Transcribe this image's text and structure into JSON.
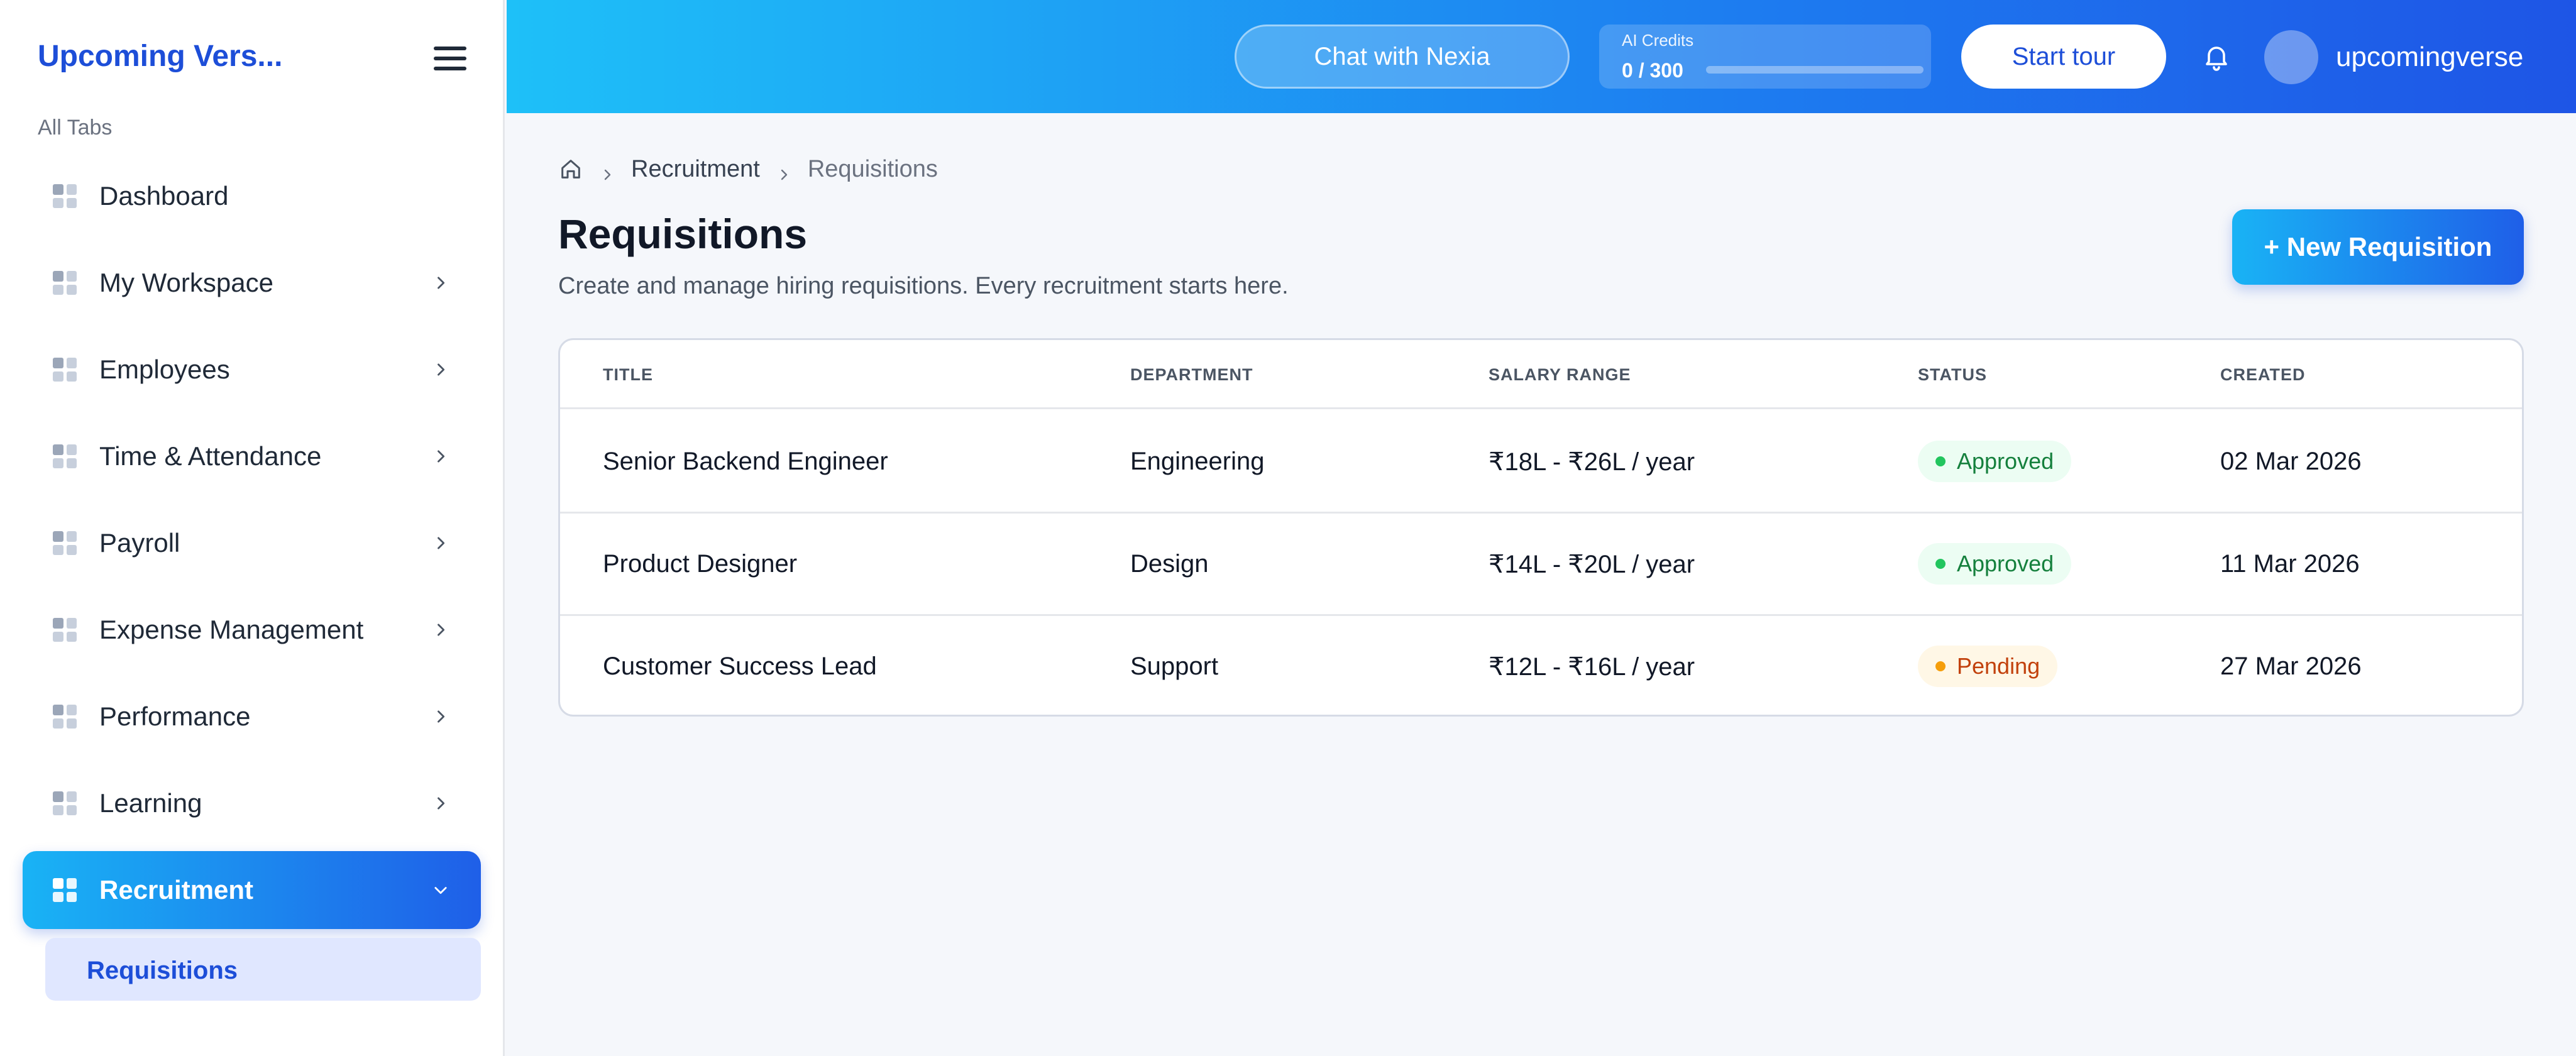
{
  "sidebar": {
    "brand": "Upcoming Vers...",
    "section_label": "All Tabs",
    "items": [
      {
        "label": "Dashboard",
        "has_chevron": false
      },
      {
        "label": "My Workspace",
        "has_chevron": true
      },
      {
        "label": "Employees",
        "has_chevron": true
      },
      {
        "label": "Time & Attendance",
        "has_chevron": true
      },
      {
        "label": "Payroll",
        "has_chevron": true
      },
      {
        "label": "Expense Management",
        "has_chevron": true
      },
      {
        "label": "Performance",
        "has_chevron": true
      },
      {
        "label": "Learning",
        "has_chevron": true
      },
      {
        "label": "Recruitment",
        "active": true,
        "expanded": true
      }
    ],
    "sub_item": "Requisitions"
  },
  "topbar": {
    "chat_label": "Chat with Nexia",
    "credits_label": "AI Credits",
    "credits_value": "0 / 300",
    "credits_used_fraction": 0.0,
    "tour_label": "Start tour",
    "username": "upcomingverse",
    "icons": [
      "bell-icon",
      "avatar"
    ]
  },
  "breadcrumb": {
    "home_icon": "home-icon",
    "items": [
      "Recruitment",
      "Requisitions"
    ]
  },
  "page": {
    "title": "Requisitions",
    "subtitle": "Create and manage hiring requisitions. Every recruitment starts here.",
    "new_button": "+ New Requisition"
  },
  "table": {
    "headers": [
      "TITLE",
      "DEPARTMENT",
      "SALARY RANGE",
      "STATUS",
      "CREATED"
    ],
    "rows": [
      {
        "title": "Senior Backend Engineer",
        "department": "Engineering",
        "salary": "₹18L - ₹26L / year",
        "status": "Approved",
        "created": "02 Mar 2026"
      },
      {
        "title": "Product Designer",
        "department": "Design",
        "salary": "₹14L - ₹20L / year",
        "status": "Approved",
        "created": "11 Mar 2026"
      },
      {
        "title": "Customer Success Lead",
        "department": "Support",
        "salary": "₹12L - ₹16L / year",
        "status": "Pending",
        "created": "27 Mar 2026"
      }
    ]
  },
  "colors": {
    "accent_start": "#19b3f5",
    "accent_end": "#1f5fe8",
    "brand": "#1d4ed8",
    "approved": "#22c55e",
    "pending": "#f59e0b"
  }
}
